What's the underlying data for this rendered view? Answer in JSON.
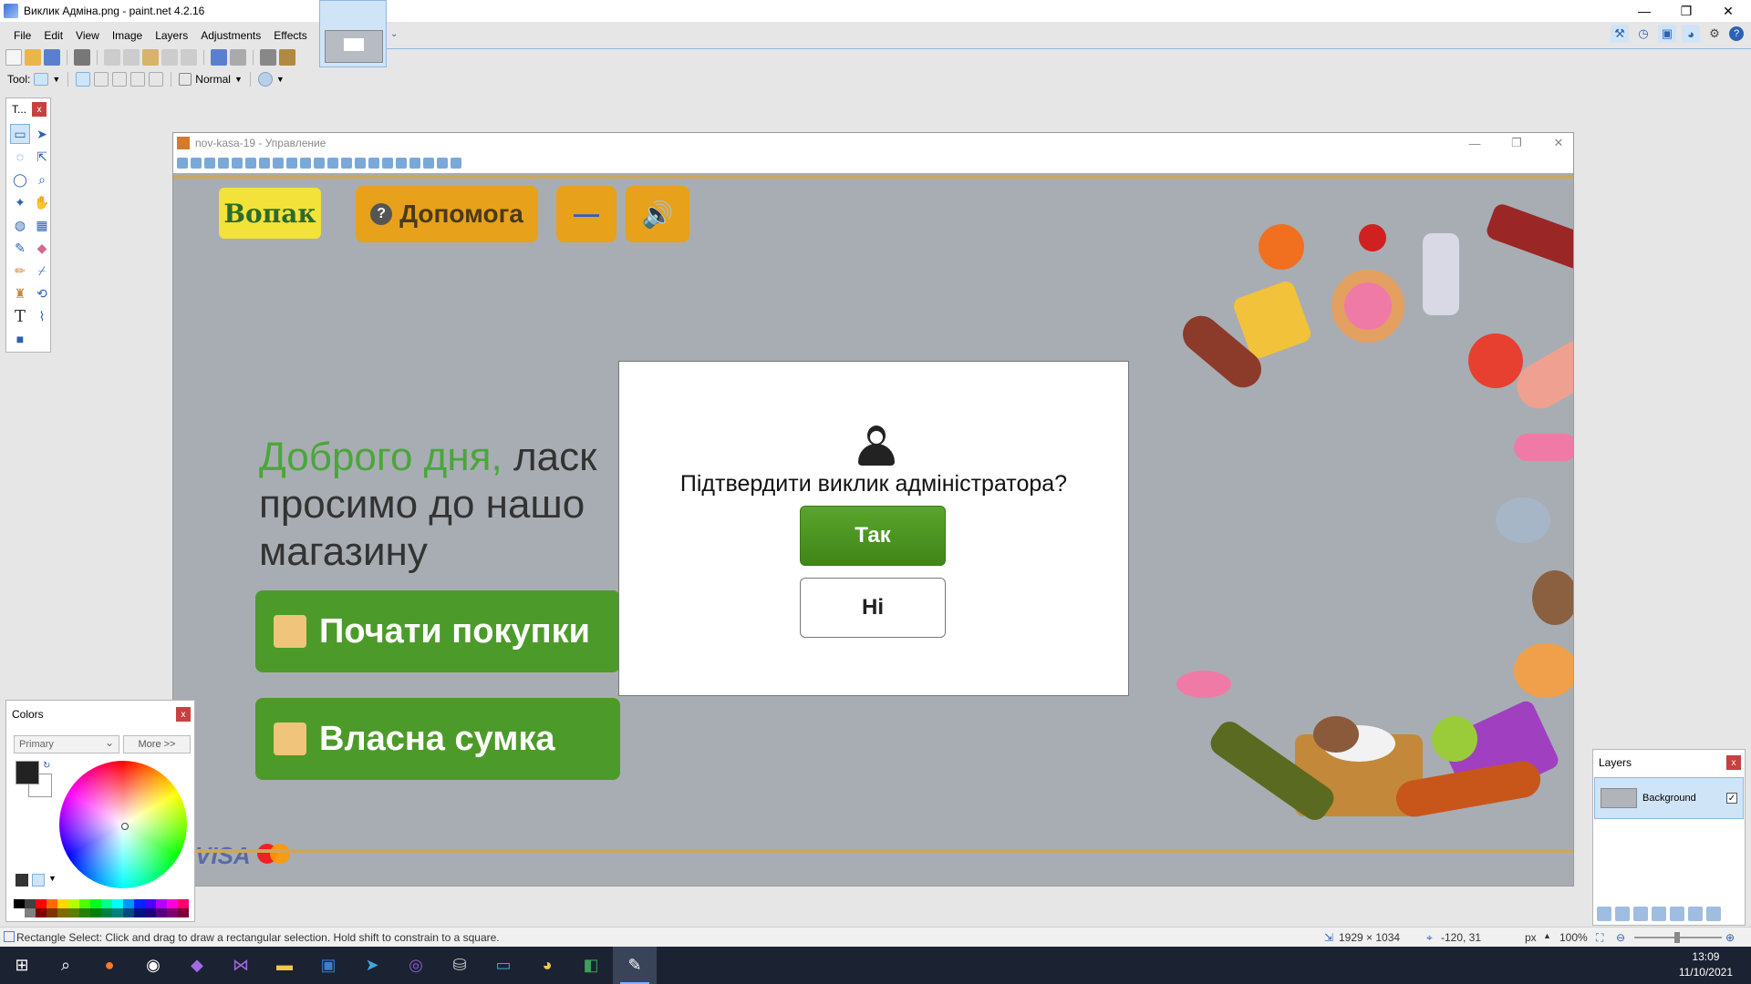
{
  "window": {
    "title": "Виклик Адміна.png - paint.net 4.2.16",
    "minimize": "—",
    "restore": "❐",
    "close": "✕"
  },
  "menu": [
    "File",
    "Edit",
    "View",
    "Image",
    "Layers",
    "Adjustments",
    "Effects"
  ],
  "toolbar": {
    "tool_label": "Tool:",
    "blend_mode": "Normal"
  },
  "tools_panel": {
    "title": "T...",
    "icons": [
      "rectangle-select-icon",
      "move-selection-icon",
      "lasso-select-icon",
      "move-selected-icon",
      "ellipse-select-icon",
      "zoom-icon",
      "magic-wand-icon",
      "pan-icon",
      "paint-bucket-icon",
      "gradient-icon",
      "paintbrush-icon",
      "eraser-icon",
      "pencil-icon",
      "color-picker-icon",
      "clone-stamp-icon",
      "recolor-icon",
      "text-icon",
      "line-curve-icon",
      "shapes-icon"
    ]
  },
  "canvas": {
    "inner_window_title": "nov-kasa-19 - Управление",
    "logo": "Вопак",
    "help_label": "Допомога",
    "minus_label": "—",
    "sound_icon": "🔊",
    "greeting_green": "Доброго дня,",
    "greeting_rest": " ласк",
    "greeting_line2": "просимо до нашо",
    "greeting_line3": "магазину",
    "start_shopping": "Почати покупки",
    "own_bag": "Власна сумка",
    "visa": "VISA"
  },
  "dialog": {
    "question": "Підтвердити виклик адміністратора?",
    "yes": "Так",
    "no": "Ні"
  },
  "colors_panel": {
    "title": "Colors",
    "mode": "Primary",
    "more": "More >>",
    "primary_color": "#222222",
    "secondary_color": "#ffffff",
    "palette": [
      "#000000",
      "#404040",
      "#ff0000",
      "#ff6a00",
      "#ffd800",
      "#b6ff00",
      "#4cff00",
      "#00ff21",
      "#00ff90",
      "#00ffff",
      "#0094ff",
      "#0026ff",
      "#4800ff",
      "#b200ff",
      "#ff00dc",
      "#ff006e",
      "#ffffff",
      "#808080",
      "#7f0000",
      "#7f3300",
      "#7f6a00",
      "#5b7f00",
      "#267f00",
      "#007f0e",
      "#007f46",
      "#007f7f",
      "#004a7f",
      "#00137f",
      "#21007f",
      "#57007f",
      "#7f006e",
      "#7f0037"
    ]
  },
  "layers_panel": {
    "title": "Layers",
    "layer_name": "Background",
    "layer_visible": "✓"
  },
  "statusbar": {
    "hint": "Rectangle Select: Click and drag to draw a rectangular selection. Hold shift to constrain to a square.",
    "image_size": "1929 × 1034",
    "cursor_pos": "-120, 31",
    "units": "px",
    "zoom": "100%"
  },
  "taskbar": {
    "time": "13:09",
    "date": "11/10/2021",
    "apps": [
      "start-icon",
      "search-icon",
      "firefox-icon",
      "word-icon",
      "slack-icon",
      "visual-studio-icon",
      "file-explorer-icon",
      "terminal-icon",
      "telegram-icon",
      "viber-icon",
      "database-icon",
      "remote-desktop-icon",
      "chrome-icon",
      "app-icon",
      "paintnet-icon"
    ]
  }
}
